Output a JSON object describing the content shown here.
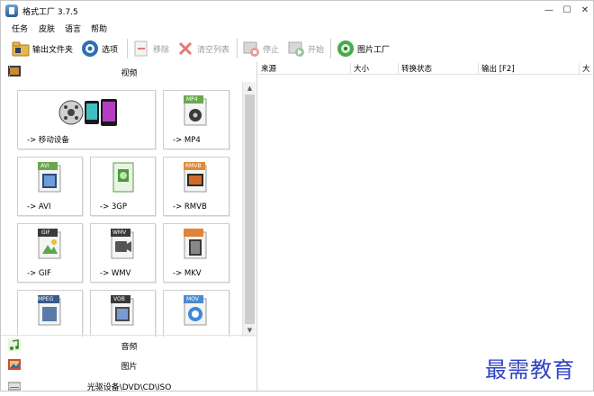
{
  "window": {
    "title": "格式工厂 3.7.5",
    "minimize_glyph": "—",
    "maximize_glyph": "☐",
    "close_glyph": "✕"
  },
  "menu": [
    "任务",
    "皮肤",
    "语言",
    "帮助"
  ],
  "toolbar": {
    "output_folder": "输出文件夹",
    "options": "选项",
    "remove": "移除",
    "clear_list": "清空列表",
    "stop": "停止",
    "start": "开始",
    "picture_factory": "图片工厂"
  },
  "left_panel": {
    "video_label": "视频",
    "audio_label": "音频",
    "picture_label": "图片",
    "disc_label": "光驱设备\\DVD\\CD\\ISO",
    "tiles": [
      {
        "label": "-> 移动设备",
        "icon": "mobile-device-icon"
      },
      {
        "label": "-> MP4",
        "badge": "MP4",
        "icon": "mp4-icon"
      },
      {
        "label": "-> AVI",
        "badge": "AVI",
        "icon": "avi-icon"
      },
      {
        "label": "-> 3GP",
        "badge": "3GP",
        "icon": "3gp-icon"
      },
      {
        "label": "-> RMVB",
        "badge": "RMVB",
        "icon": "rmvb-icon"
      },
      {
        "label": "-> GIF",
        "badge": "GIF",
        "icon": "gif-icon"
      },
      {
        "label": "-> WMV",
        "badge": "WMV",
        "icon": "wmv-icon"
      },
      {
        "label": "-> MKV",
        "badge": "MKV",
        "icon": "mkv-icon"
      },
      {
        "label": "",
        "badge": "MPEG",
        "icon": "mpeg-icon"
      },
      {
        "label": "",
        "badge": "VOB",
        "icon": "vob-icon"
      },
      {
        "label": "",
        "badge": "MOV",
        "icon": "mov-icon"
      }
    ]
  },
  "list": {
    "columns": [
      "来源",
      "大小",
      "转换状态",
      "输出 [F2]",
      "大"
    ]
  },
  "colors": {
    "accent": "#2f43c2",
    "tile_border": "#cfcfcf"
  },
  "watermark": "最需教育"
}
